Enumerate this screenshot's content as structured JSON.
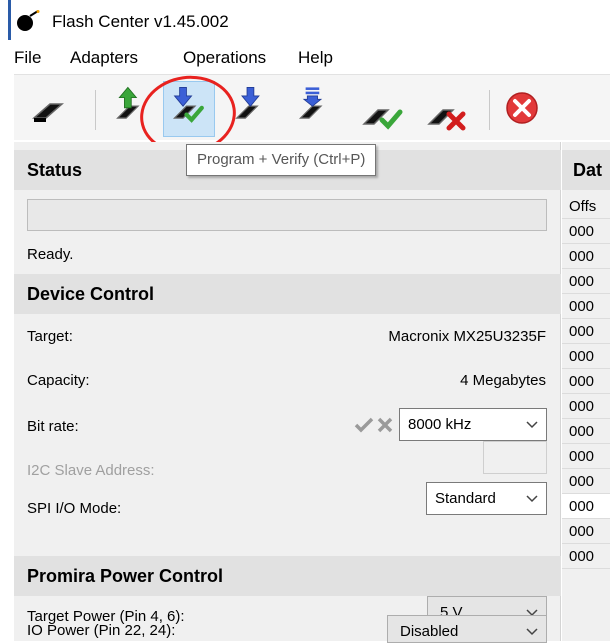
{
  "window": {
    "title": "Flash Center v1.45.002"
  },
  "menu": [
    "File",
    "Adapters",
    "Operations",
    "Help"
  ],
  "toolbar": {
    "buttons": [
      "chip-icon",
      "read-icon",
      "program-verify-icon",
      "program-icon",
      "erase-icon",
      "verify-icon",
      "remove-icon",
      "cancel-icon"
    ],
    "tooltip": "Program + Verify  (Ctrl+P)"
  },
  "status": {
    "header": "Status",
    "progress": 0,
    "text": "Ready."
  },
  "device_control": {
    "header": "Device Control",
    "target_label": "Target:",
    "target_value": "Macronix MX25U3235F",
    "capacity_label": "Capacity:",
    "capacity_value": "4 Megabytes",
    "bitrate_label": "Bit rate:",
    "bitrate_value": "8000 kHz",
    "i2c_label": "I2C Slave Address:",
    "i2c_value": "",
    "spi_label": "SPI I/O Mode:",
    "spi_value": "Standard"
  },
  "power_control": {
    "header": "Promira Power Control",
    "target_power_label": "Target Power (Pin 4, 6):",
    "target_power_value": "5 V",
    "io_power_label": "IO Power (Pin 22, 24):",
    "io_power_value": "Disabled"
  },
  "data_pane": {
    "header": "Dat",
    "column": "Offs",
    "rows": [
      "000",
      "000",
      "000",
      "000",
      "000",
      "000",
      "000",
      "000",
      "000",
      "000",
      "000",
      "000",
      "000",
      "000"
    ]
  },
  "colors": {
    "accent_red": "#e8221f",
    "highlight": "#cce4f7",
    "header_bg": "#e1e1e1",
    "pane_bg": "#f0f0f0"
  }
}
